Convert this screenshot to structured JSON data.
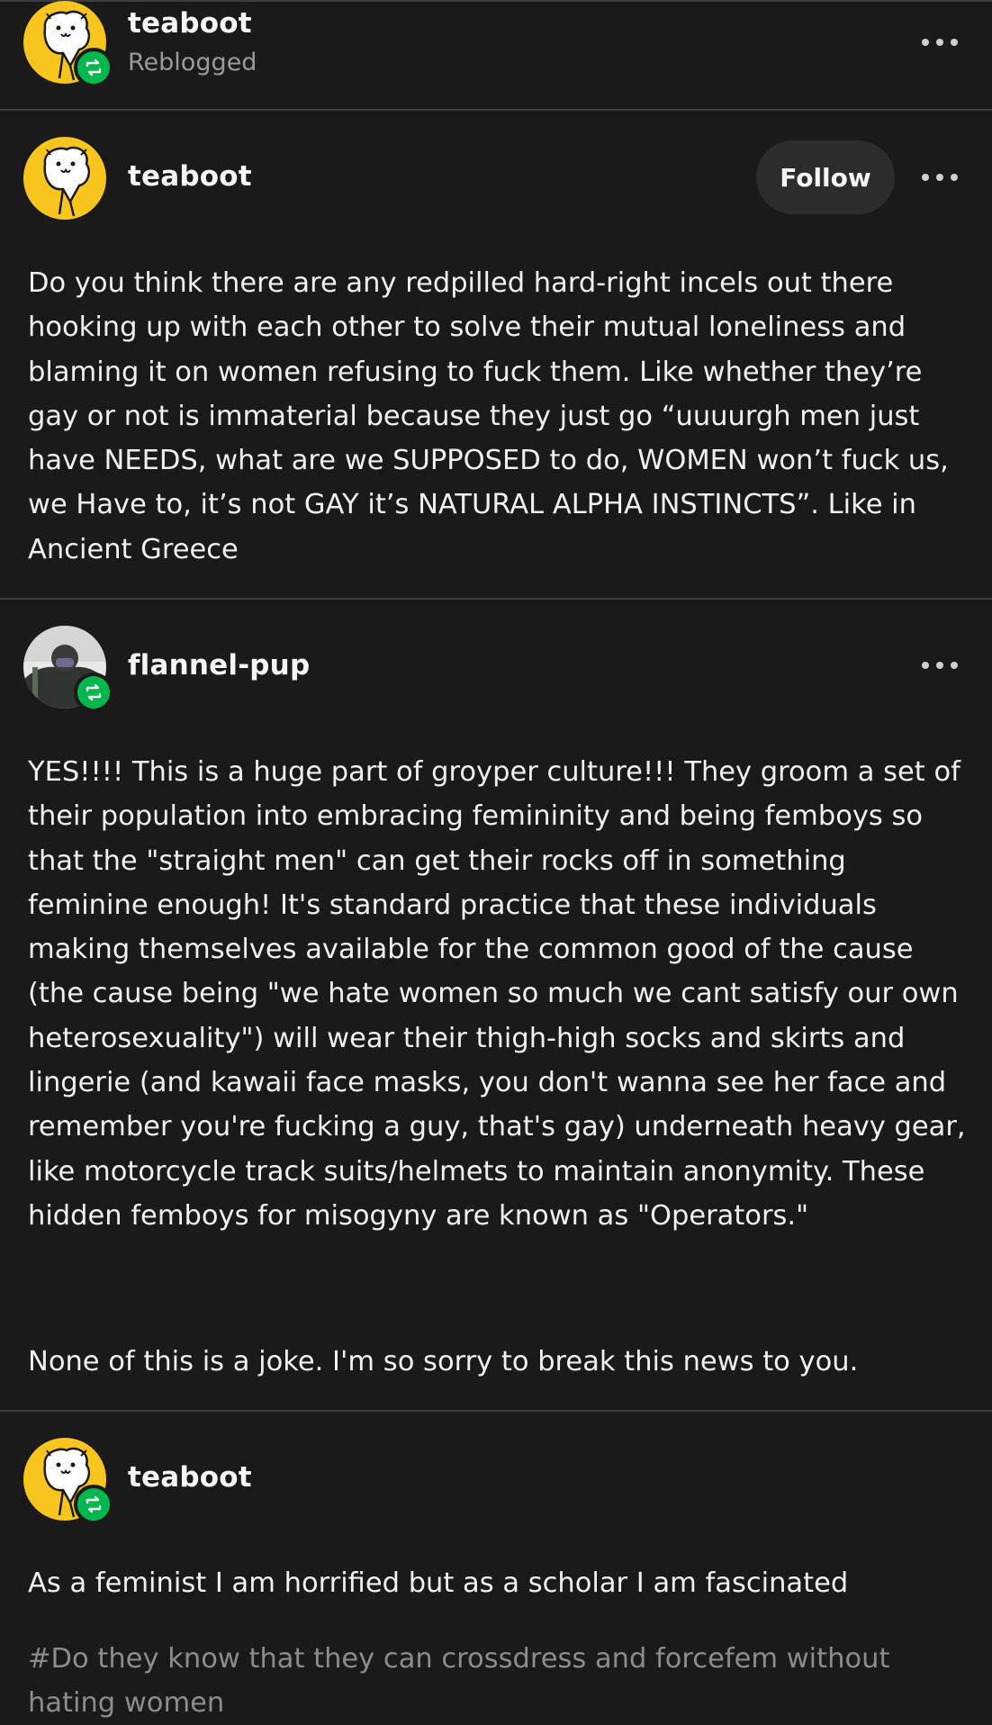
{
  "header": {
    "username": "teaboot",
    "action_label": "Reblogged",
    "avatar_icon": "teaboot-avatar-icon",
    "badge_icon": "reblog-icon"
  },
  "original_post": {
    "username": "teaboot",
    "follow_label": "Follow",
    "body": "Do you think there are any redpilled hard-right incels out there hooking up with each other to solve their mutual loneliness and blaming it on women refusing to fuck them. Like whether they’re gay or not is immaterial because they just go “uuuurgh men just have NEEDS, what are we SUPPOSED to do, WOMEN won’t fuck us, we Have to, it’s not GAY it’s NATURAL ALPHA INSTINCTS”. Like in Ancient Greece"
  },
  "reply_1": {
    "username": "flannel-pup",
    "body": "YES!!!! This is a huge part of groyper culture!!! They groom a set of their population into embracing femininity and being femboys so that the \"straight men\" can get their rocks off in something feminine enough! It's standard practice that these individuals making themselves available for the common good of the cause (the cause being \"we hate women so much we cant satisfy our own heterosexuality\") will wear their thigh-high socks and skirts and lingerie (and kawaii face masks, you don't wanna see her face and remember you're fucking a guy, that's gay) underneath heavy gear, like motorcycle track suits/helmets to maintain anonymity. These hidden femboys for misogyny are known as \"Operators.\"",
    "body_2": "None of this is a joke. I'm so sorry to break this news to you."
  },
  "reply_2": {
    "username": "teaboot",
    "body": "As a feminist I am horrified but as a scholar I am fascinated",
    "tag": "#Do they know that they can crossdress and forcefem without hating women"
  },
  "colors": {
    "background": "#1a1a1a",
    "text": "#f0f0f0",
    "muted": "#9a9a9a",
    "reblog_green": "#00b84c",
    "avatar_yellow": "#f7c51e"
  }
}
